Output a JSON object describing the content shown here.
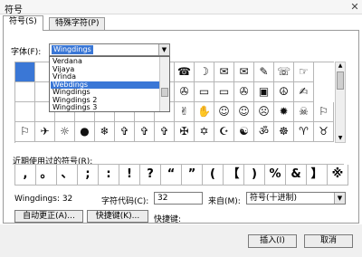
{
  "window": {
    "title": "符号"
  },
  "tabs": [
    {
      "label": "符号(S)"
    },
    {
      "label": "特殊字符(P)"
    }
  ],
  "font": {
    "label": "字体(F):",
    "value": "Wingdings",
    "options": [
      "Verdana",
      "Vijaya",
      "Vrinda",
      "Webdings",
      "Wingdings",
      "Wingdings 2",
      "Wingdings 3"
    ],
    "active_option": "Webdings"
  },
  "grid": {
    "rows": [
      [
        "",
        "",
        "",
        "",
        "",
        "",
        "",
        "",
        "☎",
        "☽",
        "✉",
        "✉",
        "✎",
        "☏",
        "☞"
      ],
      [
        "",
        "",
        "",
        "",
        "",
        "",
        "",
        "",
        "✇",
        "▭",
        "▭",
        "✇",
        "▣",
        "☮",
        "✍"
      ],
      [
        "",
        "",
        "",
        "",
        "",
        "",
        "",
        "",
        "✌",
        "✋",
        "☺",
        "☺",
        "☹",
        "✹",
        "☠",
        "⚐"
      ],
      [
        "⚐",
        "✈",
        "☼",
        "●",
        "❄",
        "✞",
        "✞",
        "✞",
        "✠",
        "✡",
        "☪",
        "☯",
        "ॐ",
        "☸",
        "♈",
        "♉"
      ]
    ]
  },
  "recent": {
    "label": "近期使用过的符号(R):",
    "symbols": [
      ",",
      "。",
      "、",
      ";",
      ":",
      "!",
      "?",
      "“",
      "”",
      "(",
      "【",
      ")",
      "%",
      "&",
      "】",
      "※"
    ]
  },
  "info": {
    "char_name": "Wingdings: 32",
    "code_label": "字符代码(C):",
    "code_value": "32",
    "from_label": "来自(M):",
    "from_value": "符号(十进制)"
  },
  "buttons": {
    "autocorrect": "自动更正(A)...",
    "shortcut_key": "快捷键(K)...",
    "shortcut_label": "快捷键:",
    "insert": "插入(I)",
    "cancel": "取消"
  }
}
